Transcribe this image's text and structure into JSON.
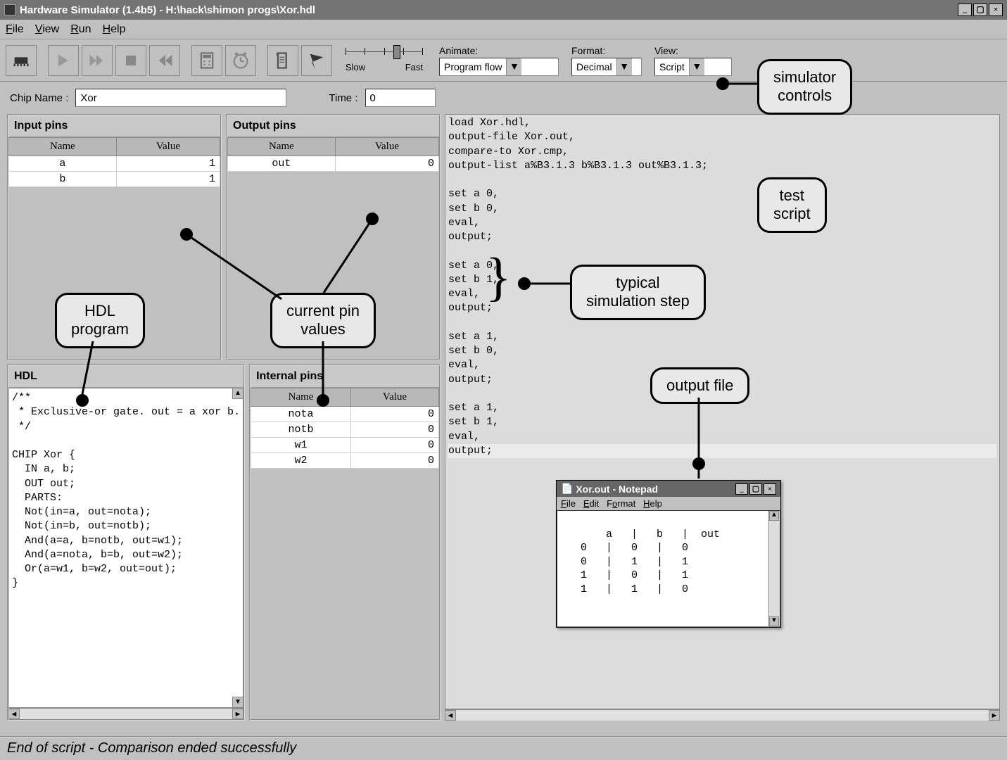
{
  "window": {
    "title": "Hardware Simulator (1.4b5) - H:\\hack\\shimon progs\\Xor.hdl",
    "min_label": "_",
    "max_label": "▢",
    "close_label": "×"
  },
  "menubar": {
    "file": "File",
    "view": "View",
    "run": "Run",
    "help": "Help"
  },
  "toolbar": {
    "animate_label": "Animate:",
    "animate_value": "Program flow",
    "format_label": "Format:",
    "format_value": "Decimal",
    "view_label": "View:",
    "view_value": "Script",
    "slow_label": "Slow",
    "fast_label": "Fast"
  },
  "chip": {
    "name_label": "Chip Name :",
    "name_value": "Xor",
    "time_label": "Time :",
    "time_value": "0"
  },
  "panels": {
    "input_title": "Input pins",
    "output_title": "Output pins",
    "internal_title": "Internal pins",
    "hdl_title": "HDL",
    "name_header": "Name",
    "value_header": "Value"
  },
  "input_pins": [
    {
      "name": "a",
      "value": "1"
    },
    {
      "name": "b",
      "value": "1"
    }
  ],
  "output_pins": [
    {
      "name": "out",
      "value": "0"
    }
  ],
  "internal_pins": [
    {
      "name": "nota",
      "value": "0"
    },
    {
      "name": "notb",
      "value": "0"
    },
    {
      "name": "w1",
      "value": "0"
    },
    {
      "name": "w2",
      "value": "0"
    }
  ],
  "hdl_code": "/**\n * Exclusive-or gate. out = a xor b.\n */\n\nCHIP Xor {\n  IN a, b;\n  OUT out;\n  PARTS:\n  Not(in=a, out=nota);\n  Not(in=b, out=notb);\n  And(a=a, b=notb, out=w1);\n  And(a=nota, b=b, out=w2);\n  Or(a=w1, b=w2, out=out);\n}",
  "script_lines": [
    "load Xor.hdl,",
    "output-file Xor.out,",
    "compare-to Xor.cmp,",
    "output-list a%B3.1.3 b%B3.1.3 out%B3.1.3;",
    "",
    "set a 0,",
    "set b 0,",
    "eval,",
    "output;",
    "",
    "set a 0,",
    "set b 1,",
    "eval,",
    "output;",
    "",
    "set a 1,",
    "set b 0,",
    "eval,",
    "output;",
    "",
    "set a 1,",
    "set b 1,",
    "eval,"
  ],
  "script_current": "output;",
  "status": "End of script - Comparison ended successfully",
  "notepad": {
    "title": "Xor.out - Notepad",
    "menu_file": "File",
    "menu_edit": "Edit",
    "menu_format": "Format",
    "menu_help": "Help",
    "body": "   a   |   b   |  out\n   0   |   0   |   0\n   0   |   1   |   1\n   1   |   0   |   1\n   1   |   1   |   0"
  },
  "callouts": {
    "sim_controls": "simulator\ncontrols",
    "test_script": "test\nscript",
    "sim_step": "typical\nsimulation step",
    "output_file": "output file",
    "pin_values": "current pin\nvalues",
    "hdl_program": "HDL\nprogram"
  }
}
